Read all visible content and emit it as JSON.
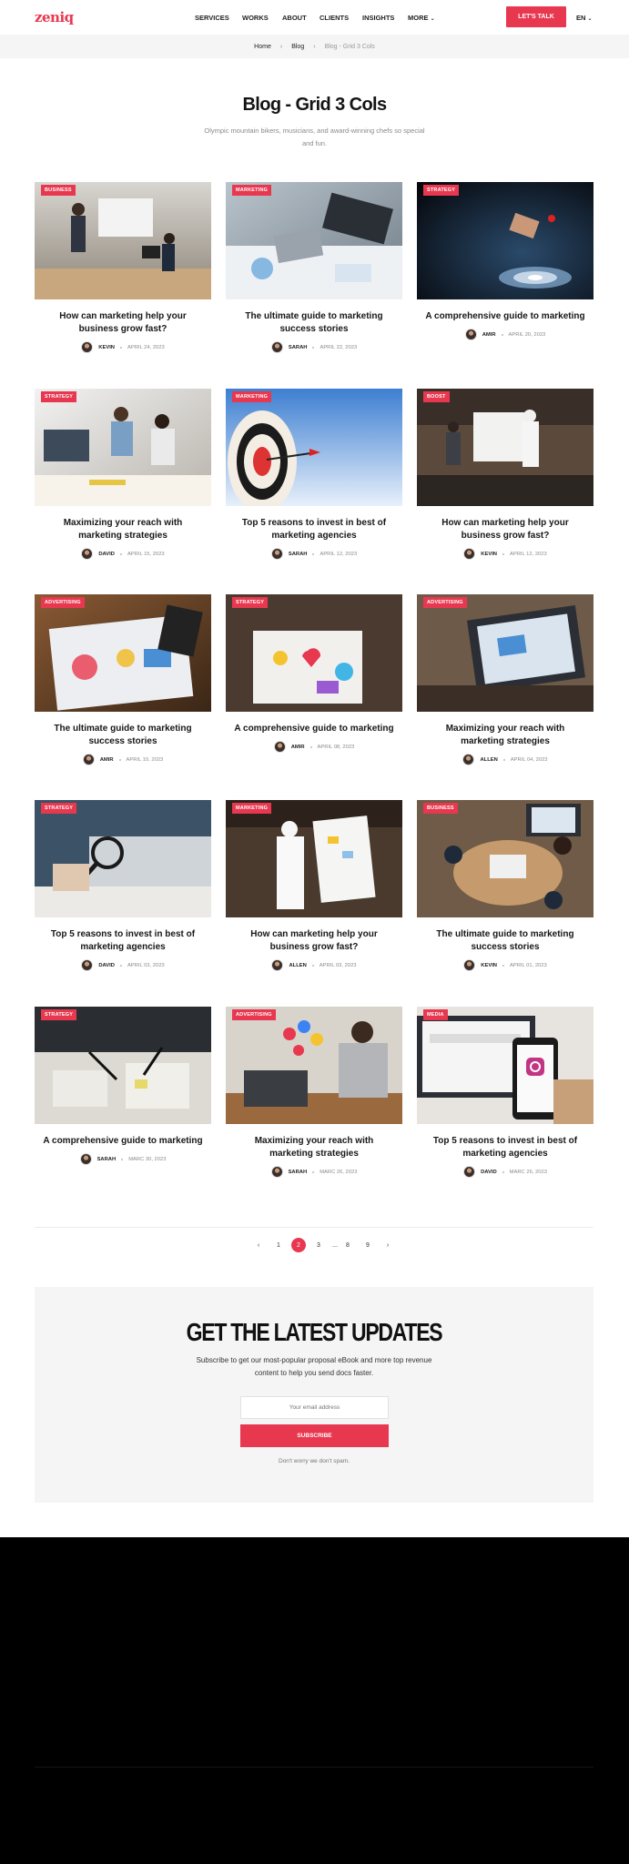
{
  "header": {
    "logo": "zeniq",
    "nav": [
      "SERVICES",
      "WORKS",
      "ABOUT",
      "CLIENTS",
      "INSIGHTS",
      "MORE"
    ],
    "cta": "LET'S TALK",
    "lang": "EN"
  },
  "breadcrumb": {
    "home": "Home",
    "blog": "Blog",
    "current": "Blog - Grid 3 Cols"
  },
  "page": {
    "title": "Blog - Grid 3 Cols",
    "subtitle": "Olympic mountain bikers, musicians, and award-winning chefs so special and fun."
  },
  "posts": [
    {
      "category": "BUSINESS",
      "title": "How can marketing help your business grow fast?",
      "author": "KEVIN",
      "date": "APRIL 24, 2023"
    },
    {
      "category": "MARKETING",
      "title": "The ultimate guide to marketing success stories",
      "author": "SARAH",
      "date": "APRIL 22, 2023"
    },
    {
      "category": "STRATEGY",
      "title": "A comprehensive guide to marketing",
      "author": "AMIR",
      "date": "APRIL 20, 2023"
    },
    {
      "category": "STRATEGY",
      "title": "Maximizing your reach with marketing strategies",
      "author": "DAVID",
      "date": "APRIL 15, 2023"
    },
    {
      "category": "MARKETING",
      "title": "Top 5 reasons to invest in best of marketing agencies",
      "author": "SARAH",
      "date": "APRIL 12, 2023"
    },
    {
      "category": "BOOST",
      "title": "How can marketing help your business grow fast?",
      "author": "KEVIN",
      "date": "APRIL 12, 2023"
    },
    {
      "category": "ADVERTISING",
      "title": "The ultimate guide to marketing success stories",
      "author": "AMIR",
      "date": "APRIL 10, 2023"
    },
    {
      "category": "STRATEGY",
      "title": "A comprehensive guide to marketing",
      "author": "AMIR",
      "date": "APRIL 08, 2023"
    },
    {
      "category": "ADVERTISING",
      "title": "Maximizing your reach with marketing strategies",
      "author": "ALLEN",
      "date": "APRIL 04, 2023"
    },
    {
      "category": "STRATEGY",
      "title": "Top 5 reasons to invest in best of marketing agencies",
      "author": "DAVID",
      "date": "APRIL 03, 2023"
    },
    {
      "category": "MARKETING",
      "title": "How can marketing help your business grow fast?",
      "author": "ALLEN",
      "date": "APRIL 03, 2023"
    },
    {
      "category": "BUSINESS",
      "title": "The ultimate guide to marketing success stories",
      "author": "KEVIN",
      "date": "APRIL 01, 2023"
    },
    {
      "category": "STRATEGY",
      "title": "A comprehensive guide to marketing",
      "author": "SARAH",
      "date": "MARC 30, 2023"
    },
    {
      "category": "ADVERTISING",
      "title": "Maximizing your reach with marketing strategies",
      "author": "SARAH",
      "date": "MARC 26, 2023"
    },
    {
      "category": "MEDIA",
      "title": "Top 5 reasons to invest in best of marketing agencies",
      "author": "DAVID",
      "date": "MARC 26, 2023"
    }
  ],
  "pagination": [
    "1",
    "2",
    "3",
    "...",
    "8",
    "9"
  ],
  "newsletter": {
    "title": "GET THE LATEST UPDATES",
    "text": "Subscribe to get our most-popular proposal eBook and more top revenue content to help you send docs faster.",
    "placeholder": "Your email address",
    "button": "SUBSCRIBE",
    "note": "Don't worry we don't spam."
  },
  "colors": {
    "accent": "#e8384f",
    "footer": "#000000",
    "band": "#f5f5f5"
  },
  "icons": {
    "more": "chevron-down-icon",
    "lang": "chevron-down-icon",
    "prev": "chevron-left-icon",
    "next": "chevron-right-icon"
  }
}
